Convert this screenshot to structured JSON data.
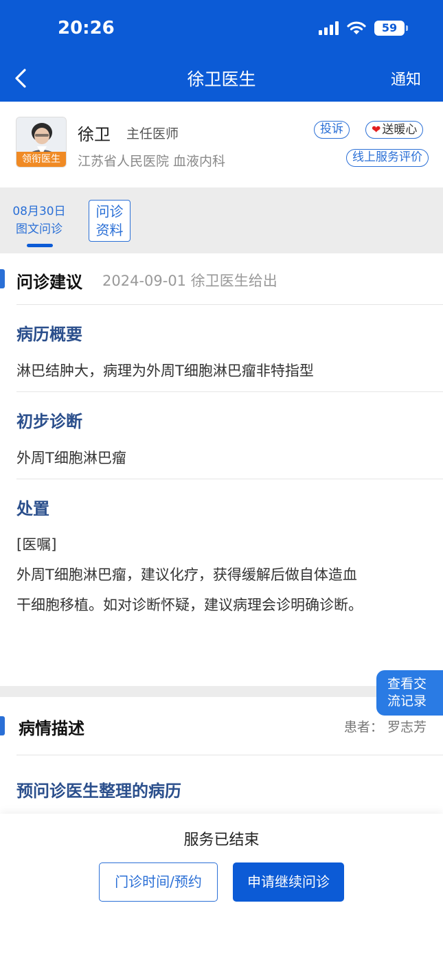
{
  "status_bar": {
    "time": "20:26",
    "battery": "59"
  },
  "nav": {
    "title": "徐卫医生",
    "notify": "通知"
  },
  "doctor": {
    "avatar_tag": "领衔医生",
    "name": "徐卫",
    "title": "主任医师",
    "hospital": "江苏省人民医院 血液内科",
    "complain_label": "投诉",
    "warm_label": "送暖心",
    "review_label": "线上服务评价"
  },
  "tabs": {
    "date": "08月30日",
    "date_sub": "图文问诊",
    "materials_line1": "问诊",
    "materials_line2": "资料"
  },
  "advice": {
    "title": "问诊建议",
    "meta": "2024-09-01 徐卫医生给出",
    "summary_title": "病历概要",
    "summary_text": "淋巴结肿大，病理为外周T细胞淋巴瘤非特指型",
    "diagnosis_title": "初步诊断",
    "diagnosis_text": "外周T细胞淋巴瘤",
    "disposal_title": "处置",
    "order_tag": "[医嘱]",
    "order_line1": "外周T细胞淋巴瘤，建议化疗，获得缓解后做自体造血",
    "order_line2": "干细胞移植。如对诊断怀疑，建议病理会诊明确诊断。"
  },
  "float_button": {
    "line1": "查看交",
    "line2": "流记录"
  },
  "condition": {
    "title": "病情描述",
    "patient_label": "患者：",
    "patient_name": "罗志芳",
    "sub_title": "预问诊医生整理的病历"
  },
  "footer": {
    "status": "服务已结束",
    "outpatient_button": "门诊时间/预约",
    "continue_button": "申请继续问诊"
  },
  "colors": {
    "primary": "#0c5bd6",
    "accent": "#2a6fd6",
    "tag_orange": "#f08a24",
    "heart_red": "#e21f1f"
  }
}
